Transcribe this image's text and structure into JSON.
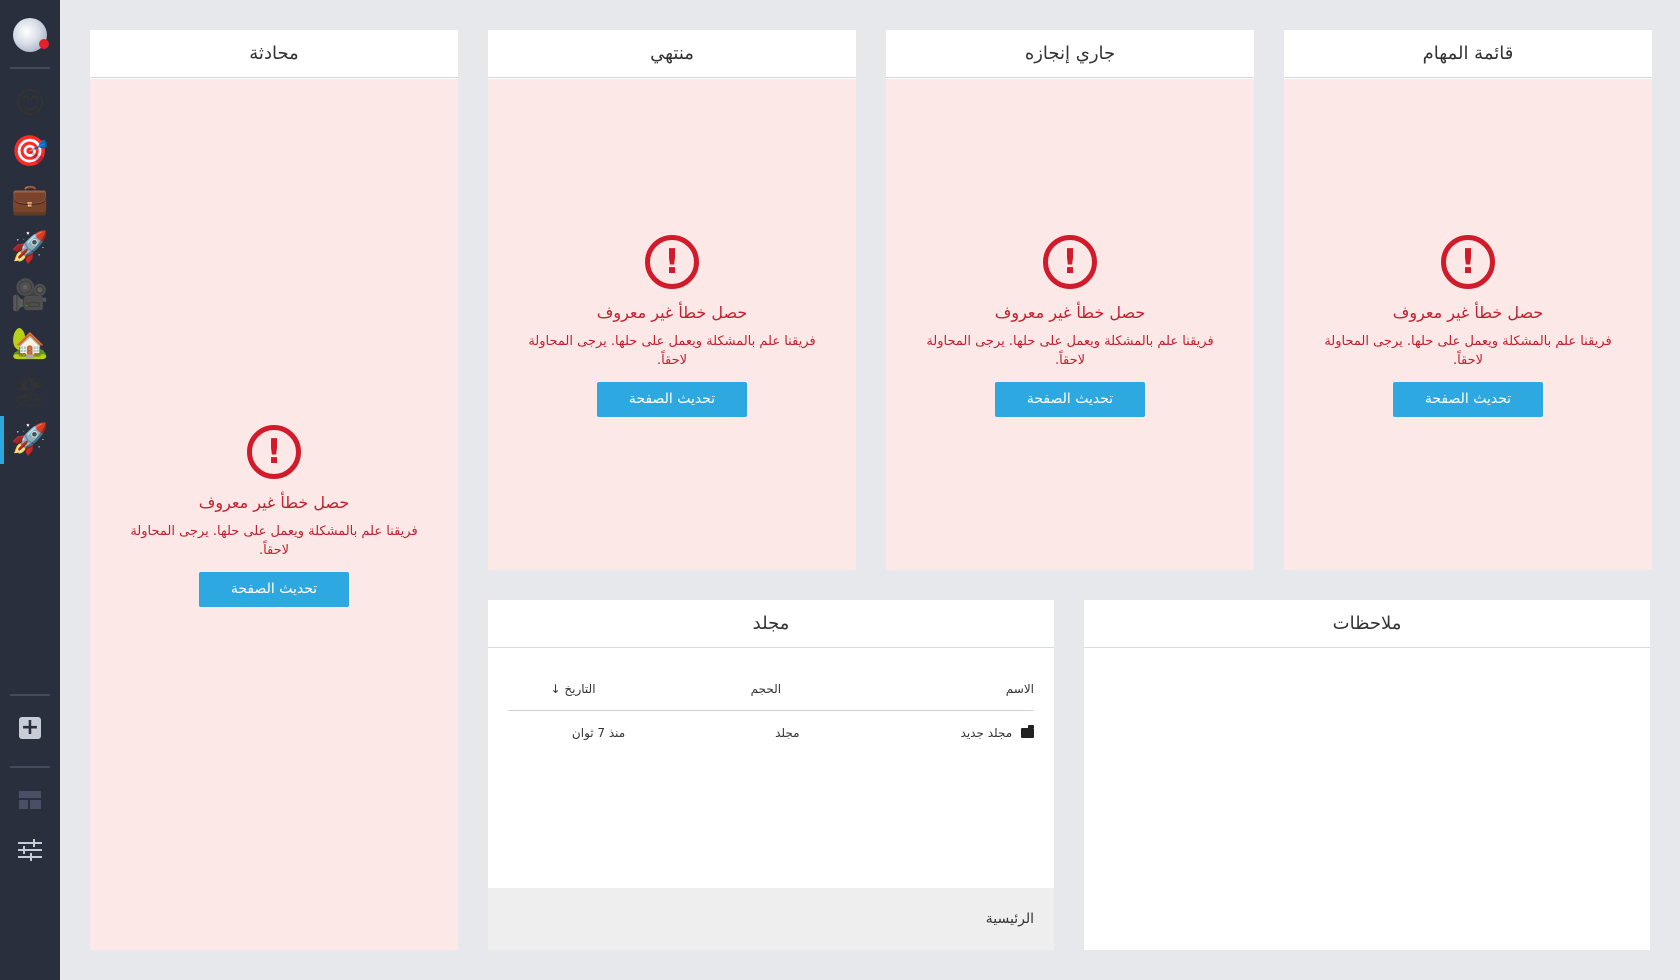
{
  "sidebar": {
    "apps": [
      {
        "name": "smiley",
        "glyph": "😊"
      },
      {
        "name": "target",
        "glyph": "🎯"
      },
      {
        "name": "briefcase",
        "glyph": "💼"
      },
      {
        "name": "rocket",
        "glyph": "🚀"
      },
      {
        "name": "movie-camera",
        "glyph": "🎥"
      },
      {
        "name": "house",
        "glyph": "🏡"
      },
      {
        "name": "beach",
        "glyph": "🏖"
      },
      {
        "name": "rocket-active",
        "glyph": "🚀"
      }
    ],
    "add_label": "+"
  },
  "error": {
    "icon": "!",
    "title": "حصل خطأ غير معروف",
    "message": "فريقنا علم بالمشكلة ويعمل على حلها. يرجى المحاولة لاحقاً.",
    "button": "تحديث الصفحة"
  },
  "panels": {
    "tasks": {
      "title": "قائمة المهام"
    },
    "in_progress": {
      "title": "جاري إنجازه"
    },
    "done": {
      "title": "منتهي"
    },
    "chat": {
      "title": "محادثة"
    },
    "notes": {
      "title": "ملاحظات"
    },
    "folder": {
      "title": "مجلد",
      "columns": {
        "name": "الاسم",
        "size": "الحجم",
        "date": "التاريخ"
      },
      "sort_arrow": "↓",
      "rows": [
        {
          "name": "مجلد جديد",
          "size": "مجلد",
          "date": "منذ 7 ثوان"
        }
      ],
      "breadcrumb": "الرئيسية"
    }
  },
  "colors": {
    "accent": "#2ea8e0",
    "error": "#d11a2a",
    "error_bg": "#fde8e8",
    "sidebar": "#2a2f3d"
  }
}
